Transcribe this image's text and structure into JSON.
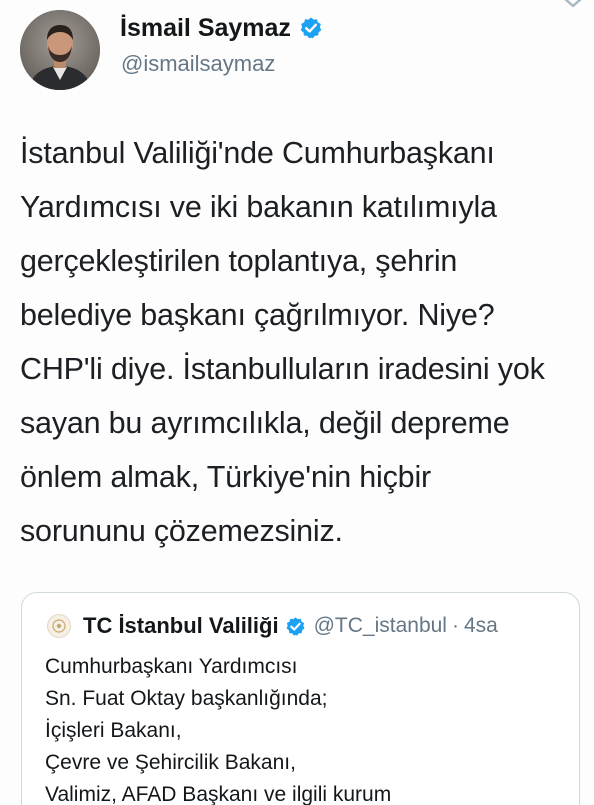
{
  "author": {
    "name": "İsmail Saymaz",
    "handle": "@ismailsaymaz",
    "verified": true,
    "avatar_icon": "profile-photo"
  },
  "tweet": {
    "lines": [
      "İstanbul Valiliği'nde Cumhurbaşkanı",
      "Yardımcısı ve iki bakanın katılımıyla",
      "gerçekleştirilen toplantıya, şehrin",
      "belediye başkanı çağrılmıyor. Niye?",
      "CHP'li diye. İstanbulluların iradesini yok",
      "sayan bu ayrımcılıkla, değil depreme",
      "önlem almak, Türkiye'nin hiçbir",
      "sorununu çözemezsiniz."
    ]
  },
  "quoted_tweet": {
    "name": "TC İstanbul Valiliği",
    "handle": "@TC_istanbul",
    "separator": "·",
    "time": "4sa",
    "verified": true,
    "lines": [
      "Cumhurbaşkanı Yardımcısı",
      "Sn. Fuat Oktay başkanlığında;",
      "İçişleri Bakanı,",
      "Çevre ve Şehircilik Bakanı,",
      "Valimiz, AFAD Başkanı ve ilgili kurum"
    ]
  },
  "colors": {
    "verified_badge": "#1da1f2",
    "secondary_text": "#657786",
    "card_border": "#cfd9de"
  },
  "icons": {
    "menu": "chevron-down-icon",
    "verified": "verified-badge-icon"
  }
}
